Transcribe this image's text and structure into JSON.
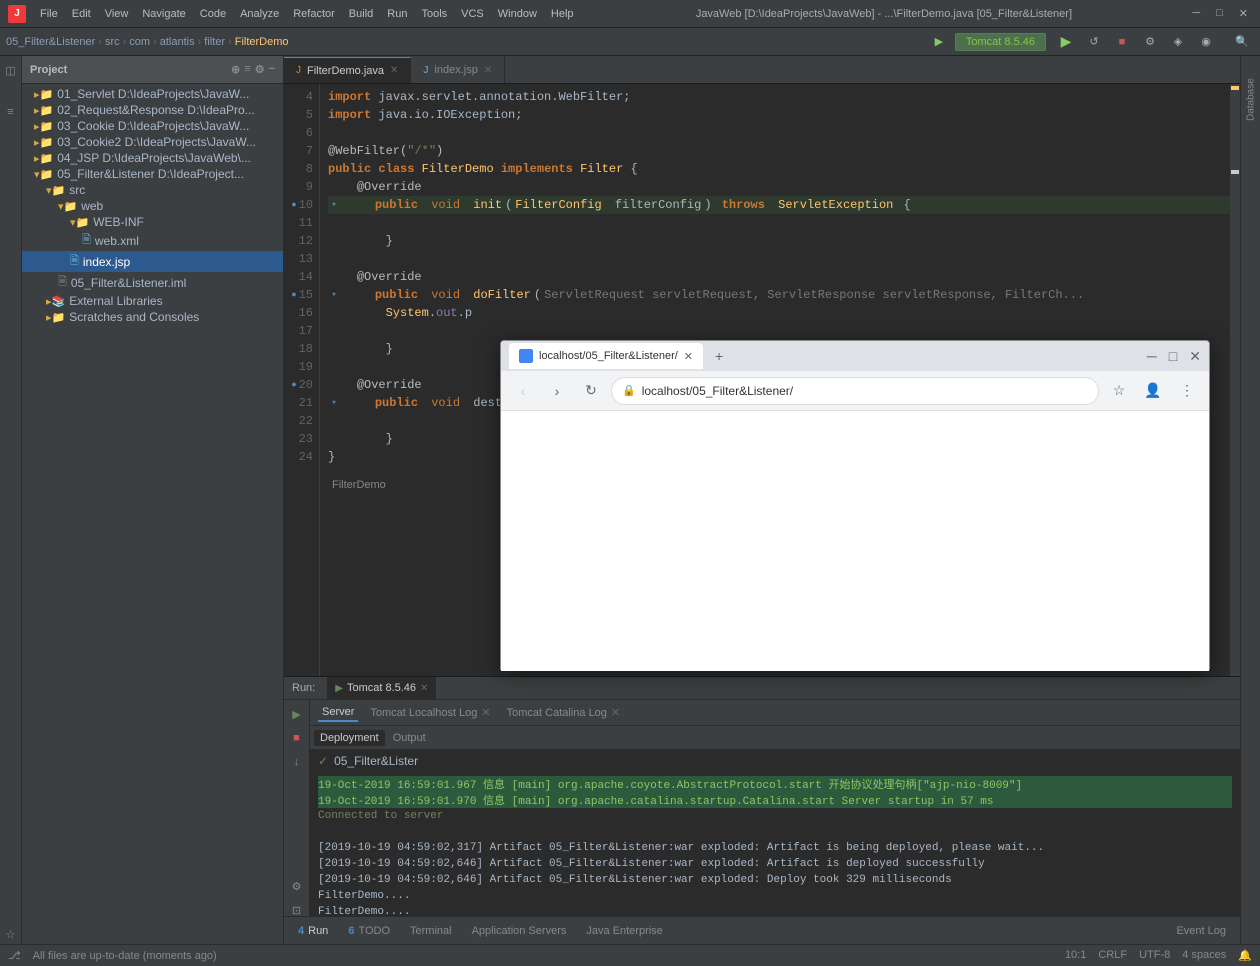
{
  "titlebar": {
    "title": "JavaWeb [D:\\IdeaProjects\\JavaWeb] - ...\\FilterDemo.java [05_Filter&Listener]",
    "menu_items": [
      "File",
      "Edit",
      "View",
      "Navigate",
      "Code",
      "Analyze",
      "Refactor",
      "Build",
      "Run",
      "Tools",
      "VCS",
      "Window",
      "Help"
    ]
  },
  "navbar": {
    "breadcrumbs": [
      "05_Filter&Listener",
      "src",
      "com",
      "atlantis",
      "filter",
      "FilterDemo"
    ],
    "run_config": "Tomcat 8.5.46"
  },
  "editor": {
    "tabs": [
      {
        "label": "FilterDemo.java",
        "type": "java",
        "active": true
      },
      {
        "label": "index.jsp",
        "type": "jsp",
        "active": false
      }
    ],
    "lines": [
      {
        "num": 4,
        "text": "import javax.servlet.annotation.WebFilter;"
      },
      {
        "num": 5,
        "text": "import java.io.IOException;"
      },
      {
        "num": 6,
        "text": ""
      },
      {
        "num": 7,
        "text": "@WebFilter(\"/*\")"
      },
      {
        "num": 8,
        "text": "public class FilterDemo implements Filter {"
      },
      {
        "num": 9,
        "text": "    @Override"
      },
      {
        "num": 10,
        "text": "    public void init(FilterConfig filterConfig) throws ServletException {"
      },
      {
        "num": 11,
        "text": ""
      },
      {
        "num": 12,
        "text": "    }"
      },
      {
        "num": 13,
        "text": ""
      },
      {
        "num": 14,
        "text": "    @Override"
      },
      {
        "num": 15,
        "text": "    public void doFilter(ServletRequest servletRequest, ServletResponse servletResponse, FilterCh"
      },
      {
        "num": 16,
        "text": "        System.out.p"
      },
      {
        "num": 17,
        "text": ""
      },
      {
        "num": 18,
        "text": "    }"
      },
      {
        "num": 19,
        "text": ""
      },
      {
        "num": 20,
        "text": "    @Override"
      },
      {
        "num": 21,
        "text": "    public void dest"
      },
      {
        "num": 22,
        "text": ""
      },
      {
        "num": 23,
        "text": "    }"
      },
      {
        "num": 24,
        "text": "}"
      }
    ],
    "bottom_label": "FilterDemo"
  },
  "browser": {
    "tab_label": "localhost/05_Filter&Listener/",
    "url": "localhost/05_Filter&Listener/",
    "new_tab_btn": "+",
    "close_btn": "✕"
  },
  "project": {
    "title": "Project",
    "items": [
      {
        "label": "01_Servlet",
        "path": "D:\\IdeaProjects\\JavaW...",
        "type": "project",
        "indent": 0
      },
      {
        "label": "02_Request&Response",
        "path": "D:\\IdeaPro...",
        "type": "project",
        "indent": 0
      },
      {
        "label": "03_Cookie",
        "path": "D:\\IdeaProjects\\JavaW...",
        "type": "project",
        "indent": 0
      },
      {
        "label": "03_Cookie2",
        "path": "D:\\IdeaProjects\\JavaW...",
        "type": "project",
        "indent": 0
      },
      {
        "label": "04_JSP",
        "path": "D:\\IdeaProjects\\JavaWeb\\...",
        "type": "project",
        "indent": 0
      },
      {
        "label": "05_Filter&Listener",
        "path": "D:\\IdeaProject...",
        "type": "project",
        "indent": 0,
        "expanded": true
      },
      {
        "label": "src",
        "type": "folder",
        "indent": 1
      },
      {
        "label": "web",
        "type": "folder",
        "indent": 2
      },
      {
        "label": "WEB-INF",
        "type": "folder",
        "indent": 3
      },
      {
        "label": "web.xml",
        "type": "xml",
        "indent": 4
      },
      {
        "label": "index.jsp",
        "type": "jsp",
        "indent": 3,
        "selected": true
      },
      {
        "label": "05_Filter&Listener.iml",
        "type": "iml",
        "indent": 2
      },
      {
        "label": "External Libraries",
        "type": "folder",
        "indent": 1
      },
      {
        "label": "Scratches and Consoles",
        "type": "folder",
        "indent": 1
      }
    ]
  },
  "run_panel": {
    "label": "Run:",
    "tab_label": "Tomcat 8.5.46",
    "subtabs": [
      "Server",
      "Tomcat Localhost Log",
      "Tomcat Catalina Log"
    ],
    "sub_tabs2": [
      "Deployment",
      "Output"
    ],
    "deployment_item": "05_Filter&Lister",
    "log_lines": [
      "19-Oct-2019 16:59:01.967 信息 [main] org.apache.coyote.AbstractProtocol.start 开始协议处理句柄[\"ajp-nio-8009\"]",
      "19-Oct-2019 16:59:01.970 信息 [main] org.apache.catalina.startup.Catalina.start Server startup in 57 ms",
      "Connected to server",
      "",
      "[2019-10-19 04:59:02,317] Artifact 05_Filter&Listener:war exploded: Artifact is being deployed, please wait...",
      "[2019-10-19 04:59:02,646] Artifact 05_Filter&Listener:war exploded: Artifact is deployed successfully",
      "[2019-10-19 04:59:02,646] Artifact 05_Filter&Listener:war exploded: Deploy took 329 milliseconds",
      "FilterDemo....",
      "FilterDemo...."
    ]
  },
  "statusbar": {
    "left_msg": "All files are up-to-date (moments ago)",
    "position": "10:1",
    "crlf": "CRLF",
    "encoding": "UTF-8",
    "indent": "4 spaces"
  },
  "bottom_toolbar": {
    "tabs": [
      {
        "num": "4",
        "label": "Run"
      },
      {
        "num": "6",
        "label": "TODO"
      },
      {
        "label": "Terminal"
      },
      {
        "label": "Application Servers"
      },
      {
        "label": "Java Enterprise"
      }
    ],
    "right_label": "Event Log"
  }
}
